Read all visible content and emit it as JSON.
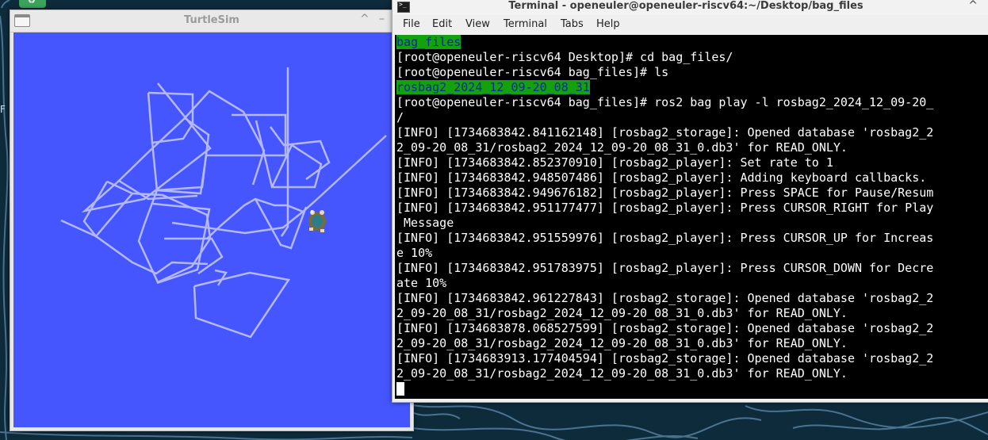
{
  "desktop": {
    "edge_text": "F"
  },
  "turtlesim": {
    "title": "TurtleSim",
    "minimize_glyph": "^",
    "close_glyph": "–",
    "canvas_color": "#4556ff",
    "trail_color": "#b3b8ff"
  },
  "terminal": {
    "title": "Terminal - openeuler@openeuler-riscv64:~/Desktop/bag_files",
    "close_glyph": "^",
    "menu": [
      "File",
      "Edit",
      "View",
      "Terminal",
      "Tabs",
      "Help"
    ],
    "lines": [
      {
        "hl": "bag_files",
        "text": ""
      },
      {
        "hl": "",
        "text": "[root@openeuler-riscv64 Desktop]# cd bag_files/"
      },
      {
        "hl": "",
        "text": "[root@openeuler-riscv64 bag_files]# ls"
      },
      {
        "hl": "rosbag2_2024_12_09-20_08_31",
        "text": ""
      },
      {
        "hl": "",
        "text": "[root@openeuler-riscv64 bag_files]# ros2 bag play -l rosbag2_2024_12_09-20_"
      },
      {
        "hl": "",
        "text": "/"
      },
      {
        "hl": "",
        "text": "[INFO] [1734683842.841162148] [rosbag2_storage]: Opened database 'rosbag2_2"
      },
      {
        "hl": "",
        "text": "2_09-20_08_31/rosbag2_2024_12_09-20_08_31_0.db3' for READ_ONLY."
      },
      {
        "hl": "",
        "text": "[INFO] [1734683842.852370910] [rosbag2_player]: Set rate to 1"
      },
      {
        "hl": "",
        "text": "[INFO] [1734683842.948507486] [rosbag2_player]: Adding keyboard callbacks."
      },
      {
        "hl": "",
        "text": "[INFO] [1734683842.949676182] [rosbag2_player]: Press SPACE for Pause/Resum"
      },
      {
        "hl": "",
        "text": "[INFO] [1734683842.951177477] [rosbag2_player]: Press CURSOR_RIGHT for Play"
      },
      {
        "hl": "",
        "text": " Message"
      },
      {
        "hl": "",
        "text": "[INFO] [1734683842.951559976] [rosbag2_player]: Press CURSOR_UP for Increas"
      },
      {
        "hl": "",
        "text": "e 10%"
      },
      {
        "hl": "",
        "text": "[INFO] [1734683842.951783975] [rosbag2_player]: Press CURSOR_DOWN for Decre"
      },
      {
        "hl": "",
        "text": "ate 10%"
      },
      {
        "hl": "",
        "text": "[INFO] [1734683842.961227843] [rosbag2_storage]: Opened database 'rosbag2_2"
      },
      {
        "hl": "",
        "text": "2_09-20_08_31/rosbag2_2024_12_09-20_08_31_0.db3' for READ_ONLY."
      },
      {
        "hl": "",
        "text": "[INFO] [1734683878.068527599] [rosbag2_storage]: Opened database 'rosbag2_2"
      },
      {
        "hl": "",
        "text": "2_09-20_08_31/rosbag2_2024_12_09-20_08_31_0.db3' for READ_ONLY."
      },
      {
        "hl": "",
        "text": "[INFO] [1734683913.177404594] [rosbag2_storage]: Opened database 'rosbag2_2"
      },
      {
        "hl": "",
        "text": "2_09-20_08_31/rosbag2_2024_12_09-20_08_31_0.db3' for READ_ONLY."
      }
    ],
    "highlight_color": "#13a10e"
  }
}
